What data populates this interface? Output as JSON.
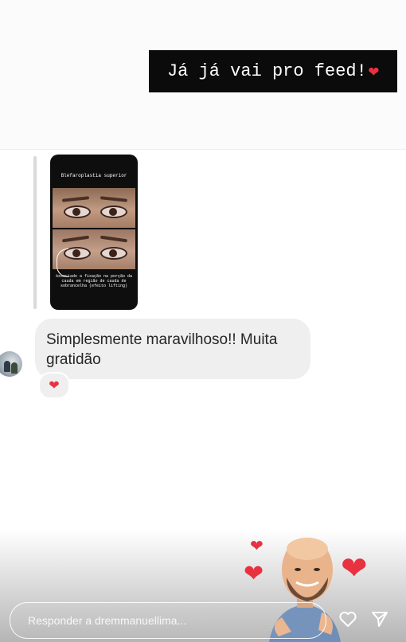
{
  "story": {
    "sticker_text": "Já já vai pro feed!",
    "sticker_emoji": "❤",
    "card_title": "Blefaroplastia superior",
    "card_caption": "Associado a fixação na porção da cauda em região de cauda de sobrancelha (efeito lifting)"
  },
  "message": {
    "text": "Simplesmente maravilhoso!! Muita gratidão",
    "reaction_emoji": "❤"
  },
  "composer": {
    "placeholder": "Responder a dremmanuellima..."
  },
  "icons": {
    "like": "heart-outline-icon",
    "send": "paper-plane-icon"
  },
  "colors": {
    "accent_red": "#e8323f",
    "bubble_bg": "#efefef",
    "sticker_bg": "#0b0b0b"
  }
}
